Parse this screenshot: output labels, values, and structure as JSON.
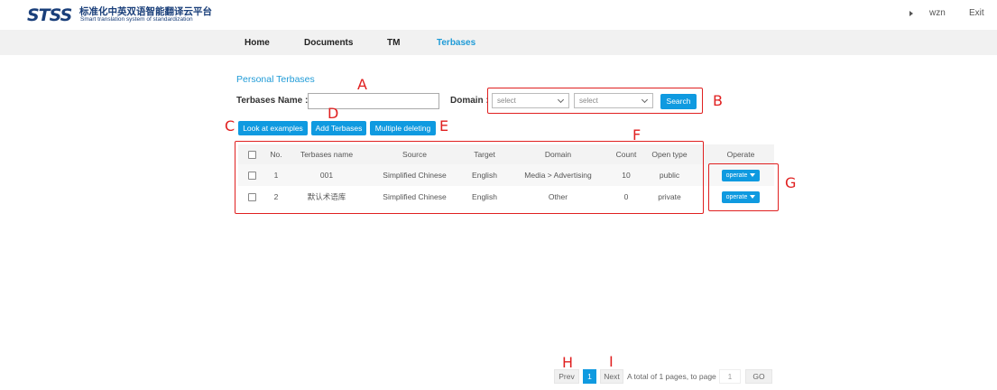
{
  "header": {
    "logo_mark": "STSS",
    "logo_title_zh": "标准化中英双语智能翻译云平台",
    "logo_title_en": "Smart translation system of standardization",
    "username": "wzn",
    "exit_label": "Exit"
  },
  "nav": {
    "items": [
      {
        "label": "Home"
      },
      {
        "label": "Documents"
      },
      {
        "label": "TM"
      },
      {
        "label": "Terbases"
      }
    ],
    "active": "Terbases"
  },
  "page": {
    "section_title": "Personal Terbases",
    "name_label": "Terbases Name :",
    "name_value": "",
    "domain_label": "Domain :",
    "domain_select_1": "select",
    "domain_select_2": "select",
    "search_label": "Search",
    "examples_label": "Look at examples",
    "add_label": "Add Terbases",
    "multi_delete_label": "Multiple deleting"
  },
  "annotations": {
    "A": "A",
    "B": "B",
    "C": "C",
    "D": "D",
    "E": "E",
    "F": "F",
    "G": "G",
    "H": "H",
    "I": "I"
  },
  "table": {
    "headers": {
      "no": "No.",
      "name": "Terbases name",
      "source": "Source",
      "target": "Target",
      "domain": "Domain",
      "count": "Count",
      "open_type": "Open type",
      "operate": "Operate"
    },
    "rows": [
      {
        "no": "1",
        "name": "001",
        "source": "Simplified Chinese",
        "target": "English",
        "domain": "Media > Advertising",
        "count": "10",
        "open_type": "public",
        "operate": "operate"
      },
      {
        "no": "2",
        "name": "默认术语库",
        "source": "Simplified Chinese",
        "target": "English",
        "domain": "Other",
        "count": "0",
        "open_type": "private",
        "operate": "operate"
      }
    ]
  },
  "pagination": {
    "prev": "Prev",
    "current": "1",
    "next": "Next",
    "summary": "A total of 1 pages, to page",
    "page_input": "1",
    "go": "GO"
  },
  "colors": {
    "accent": "#0f9ae0",
    "annotation": "#e02020",
    "brand": "#1a3f7a"
  }
}
